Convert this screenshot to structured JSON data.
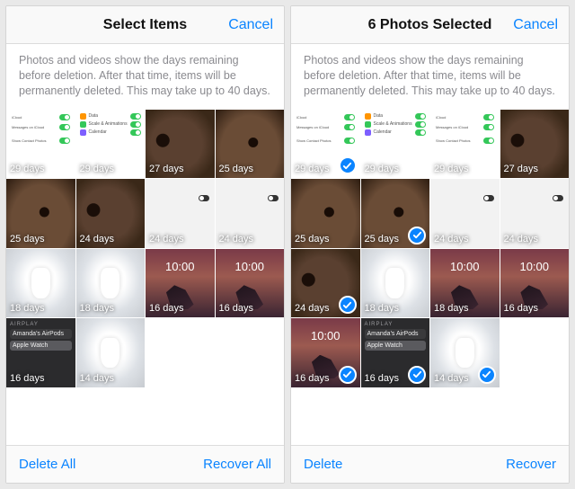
{
  "left": {
    "title": "Select Items",
    "cancel": "Cancel",
    "info": "Photos and videos show the days remaining before deletion. After that time, items will be permanently deleted. This may take up to 40 days.",
    "toolbar": {
      "left": "Delete All",
      "right": "Recover All"
    },
    "photos": [
      {
        "days": "29 days",
        "art": "settings",
        "selected": false
      },
      {
        "days": "29 days",
        "art": "set2",
        "selected": false
      },
      {
        "days": "27 days",
        "art": "fur",
        "selected": false
      },
      {
        "days": "25 days",
        "art": "fur2",
        "selected": false
      },
      {
        "days": "25 days",
        "art": "fur2",
        "selected": false
      },
      {
        "days": "24 days",
        "art": "fur",
        "selected": false
      },
      {
        "days": "24 days",
        "art": "white",
        "selected": false
      },
      {
        "days": "24 days",
        "art": "white",
        "selected": false
      },
      {
        "days": "18 days",
        "art": "airpods",
        "selected": false
      },
      {
        "days": "18 days",
        "art": "airpods",
        "selected": false
      },
      {
        "days": "16 days",
        "art": "sunset",
        "selected": false,
        "clock": "10:00"
      },
      {
        "days": "16 days",
        "art": "sunset",
        "selected": false,
        "clock": "10:00"
      },
      {
        "days": "16 days",
        "art": "airplay",
        "selected": false
      },
      {
        "days": "14 days",
        "art": "airpods",
        "selected": false
      }
    ]
  },
  "right": {
    "title": "6 Photos Selected",
    "cancel": "Cancel",
    "info": "Photos and videos show the days remaining before deletion. After that time, items will be permanently deleted. This may take up to 40 days.",
    "toolbar": {
      "left": "Delete",
      "right": "Recover"
    },
    "photos": [
      {
        "days": "29 days",
        "art": "settings",
        "selected": true
      },
      {
        "days": "29 days",
        "art": "set2",
        "selected": false
      },
      {
        "days": "29 days",
        "art": "settings",
        "selected": false
      },
      {
        "days": "27 days",
        "art": "fur",
        "selected": false
      },
      {
        "days": "25 days",
        "art": "fur2",
        "selected": false
      },
      {
        "days": "25 days",
        "art": "fur2",
        "selected": true
      },
      {
        "days": "24 days",
        "art": "white",
        "selected": false
      },
      {
        "days": "24 days",
        "art": "white",
        "selected": false
      },
      {
        "days": "24 days",
        "art": "fur",
        "selected": true
      },
      {
        "days": "18 days",
        "art": "airpods",
        "selected": false
      },
      {
        "days": "18 days",
        "art": "sunset",
        "selected": false,
        "clock": "10:00"
      },
      {
        "days": "16 days",
        "art": "sunset",
        "selected": false,
        "clock": "10:00"
      },
      {
        "days": "16 days",
        "art": "sunset",
        "selected": true,
        "clock": "10:00"
      },
      {
        "days": "16 days",
        "art": "airplay",
        "selected": true
      },
      {
        "days": "14 days",
        "art": "airpods",
        "selected": true
      }
    ]
  },
  "airplay": {
    "header": "AIRPLAY",
    "device1": "Amanda's AirPods",
    "device2": "Apple Watch"
  },
  "colors": {
    "accent": "#0a84ff"
  }
}
